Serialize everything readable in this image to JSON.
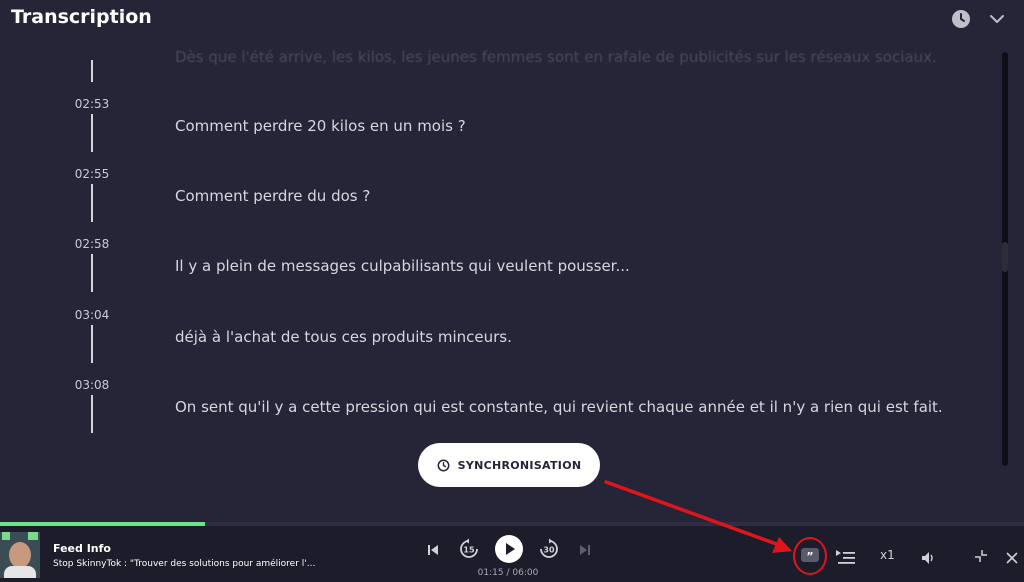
{
  "header": {
    "title": "Transcription",
    "clock_icon": "clock-icon",
    "collapse_icon": "chevron-down-icon"
  },
  "transcript": {
    "faded_text": "Dès que l'été arrive, les kilos, les jeunes femmes sont en rafale de publicités sur les réseaux sociaux.",
    "entries": [
      {
        "time": "02:53",
        "text": "Comment perdre 20 kilos en un mois ?"
      },
      {
        "time": "02:55",
        "text": "Comment perdre du dos ?"
      },
      {
        "time": "02:58",
        "text": "Il y a plein de messages culpabilisants qui veulent pousser..."
      },
      {
        "time": "03:04",
        "text": "déjà à l'achat de tous ces produits minceurs."
      },
      {
        "time": "03:08",
        "text": "On sent qu'il y a cette pression qui est constante, qui revient chaque année et il n'y a rien qui est fait."
      }
    ]
  },
  "sync_button": {
    "label": "SYNCHRONISATION",
    "icon": "clock-icon"
  },
  "player": {
    "progress_fraction": 0.2,
    "track_title": "Feed Info",
    "track_subtitle": "Stop SkinnyTok : \"Trouver des solutions pour améliorer l'...",
    "time_readout": "01:15 / 06:00",
    "skip_back_seconds": "15",
    "skip_forward_seconds": "30",
    "speed": "x1",
    "icons": [
      "skip-previous-icon",
      "rewind-15-icon",
      "play-icon",
      "forward-30-icon",
      "skip-next-icon",
      "quote-icon",
      "playlist-icon",
      "volume-icon",
      "minimize-icon",
      "close-icon"
    ]
  },
  "colors": {
    "background": "#262537",
    "player_background": "#1d1c2b",
    "progress": "#6ce28a",
    "annotation_red": "#e0151b"
  }
}
